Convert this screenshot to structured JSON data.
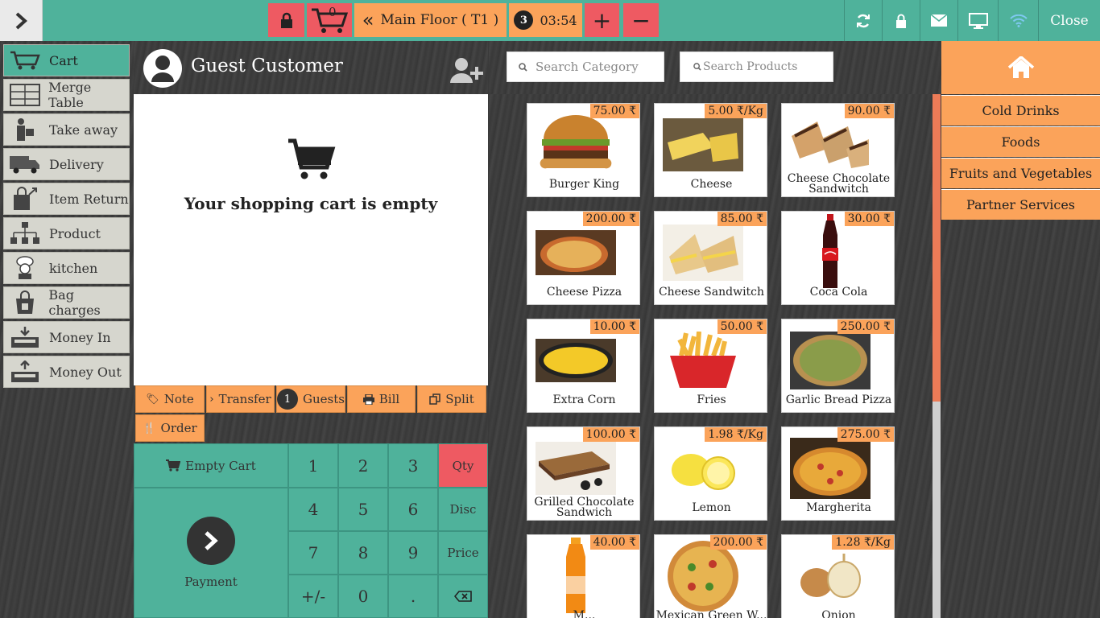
{
  "topbar": {
    "cart_count": "0",
    "floor_label": "Main Floor ( T1 )",
    "guests_badge": "3",
    "timer": "03:54",
    "plus_label": "+",
    "minus_label": "−",
    "close_label": "Close"
  },
  "sidebar": {
    "items": [
      {
        "label": "Cart",
        "icon": "cart-icon"
      },
      {
        "label": "Merge Table",
        "icon": "merge-table-icon"
      },
      {
        "label": "Take away",
        "icon": "take-away-icon"
      },
      {
        "label": "Delivery",
        "icon": "delivery-truck-icon"
      },
      {
        "label": "Item Return",
        "icon": "item-return-icon"
      },
      {
        "label": "Product",
        "icon": "product-icon"
      },
      {
        "label": "kitchen",
        "icon": "chef-icon"
      },
      {
        "label": "Bag charges",
        "icon": "bag-icon"
      },
      {
        "label": "Money In",
        "icon": "money-in-icon"
      },
      {
        "label": "Money Out",
        "icon": "money-out-icon"
      }
    ]
  },
  "cart": {
    "customer_name": "Guest Customer",
    "empty_text": "Your shopping cart is empty"
  },
  "actions": {
    "note": "Note",
    "transfer": "Transfer",
    "guests_count": "1",
    "guests": "Guests",
    "bill": "Bill",
    "split": "Split",
    "order": "Order"
  },
  "keypad": {
    "empty_cart": "Empty Cart",
    "payment": "Payment",
    "keys": [
      "1",
      "2",
      "3",
      "4",
      "5",
      "6",
      "7",
      "8",
      "9",
      "+/-",
      "0",
      "."
    ],
    "qty": "Qty",
    "disc": "Disc",
    "price": "Price"
  },
  "search": {
    "category_placeholder": "Search Category",
    "products_placeholder": "Search Products"
  },
  "products": [
    {
      "name": "Burger King",
      "price": "75.00 ₹"
    },
    {
      "name": "Cheese",
      "price": "5.00 ₹/Kg"
    },
    {
      "name": "Cheese Chocolate Sandwitch",
      "price": "90.00 ₹"
    },
    {
      "name": "Cheese Pizza",
      "price": "200.00 ₹"
    },
    {
      "name": "Cheese Sandwitch",
      "price": "85.00 ₹"
    },
    {
      "name": "Coca Cola",
      "price": "30.00 ₹"
    },
    {
      "name": "Extra Corn",
      "price": "10.00 ₹"
    },
    {
      "name": "Fries",
      "price": "50.00 ₹"
    },
    {
      "name": "Garlic Bread Pizza",
      "price": "250.00 ₹"
    },
    {
      "name": "Grilled Chocolate Sandwich",
      "price": "100.00 ₹"
    },
    {
      "name": "Lemon",
      "price": "1.98 ₹/Kg"
    },
    {
      "name": "Margherita",
      "price": "275.00 ₹"
    },
    {
      "name": "M...",
      "price": "40.00 ₹"
    },
    {
      "name": "Mexican Green W...",
      "price": "200.00 ₹"
    },
    {
      "name": "Onion",
      "price": "1.28 ₹/Kg"
    }
  ],
  "categories": {
    "items": [
      "Cold Drinks",
      "Foods",
      "Fruits and Vegetables",
      "Partner Services"
    ]
  },
  "colors": {
    "teal": "#4fb29b",
    "orange": "#fba35a",
    "red": "#ee5a62"
  }
}
